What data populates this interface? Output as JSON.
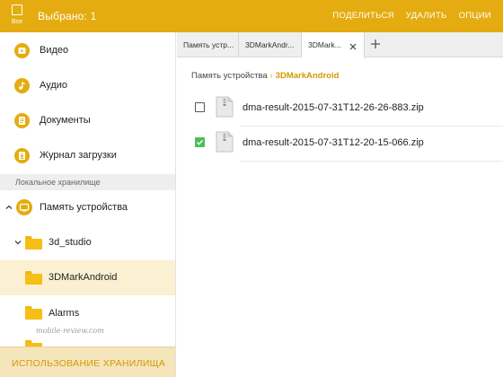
{
  "appbar": {
    "select_all_label": "Все",
    "title": "Выбрано: 1",
    "actions": [
      "ПОДЕЛИТЬСЯ",
      "УДАЛИТЬ",
      "ОПЦИИ"
    ],
    "color": "#e4ac10"
  },
  "sidebar": {
    "categories": [
      {
        "label": "Видео",
        "icon": "video-icon"
      },
      {
        "label": "Аудио",
        "icon": "audio-icon"
      },
      {
        "label": "Документы",
        "icon": "document-icon"
      },
      {
        "label": "Журнал загрузки",
        "icon": "download-history-icon"
      }
    ],
    "section_header": "Локальное хранилище",
    "tree": [
      {
        "label": "Память устройства",
        "expanded": true,
        "icon": "device-storage-icon"
      },
      {
        "label": "3d_studio",
        "expanded": true,
        "icon": "folder-icon"
      },
      {
        "label": "3DMarkAndroid",
        "selected": true,
        "icon": "folder-icon"
      },
      {
        "label": "Alarms",
        "icon": "folder-icon"
      }
    ],
    "footer": "ИСПОЛЬЗОВАНИЕ ХРАНИЛИЩА"
  },
  "tabs": [
    {
      "label": "Память устр..."
    },
    {
      "label": "3DMarkAndr..."
    },
    {
      "label": "3DMark...",
      "active": true
    }
  ],
  "breadcrumb": {
    "items": [
      "Память устройства",
      "3DMarkAndroid"
    ]
  },
  "files": [
    {
      "name": "dma-result-2015-07-31T12-26-26-883.zip",
      "checked": false
    },
    {
      "name": "dma-result-2015-07-31T12-20-15-066.zip",
      "checked": true
    }
  ],
  "watermark": "mobile-review.com",
  "colors": {
    "accent": "#e4ac10",
    "selected_row": "#fbf0d2",
    "checkbox_checked": "#4dbd57",
    "footer_bg": "#f5e5bb"
  }
}
